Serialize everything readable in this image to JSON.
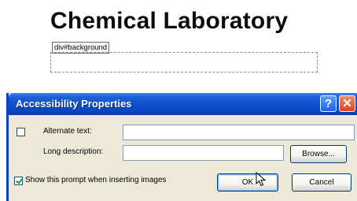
{
  "editor": {
    "title": "Chemical Laboratory",
    "div_tag": "div#background"
  },
  "dialog": {
    "title": "Accessibility Properties",
    "help_glyph": "?",
    "close_glyph": "✕",
    "alternate_text_label": "Alternate text:",
    "alternate_text_value": "",
    "alternate_text_checked": false,
    "long_description_label": "Long description:",
    "long_description_value": "",
    "browse_label": "Browse...",
    "show_prompt_label": "Show this prompt when inserting images",
    "show_prompt_checked": true,
    "ok_label": "OK",
    "cancel_label": "Cancel"
  },
  "colors": {
    "titlebar": "#0b4fd0",
    "dialog_bg": "#ece9d8",
    "close_button": "#d9432b",
    "check_mark": "#21a121"
  },
  "icons": {
    "help": "help-icon",
    "close": "close-icon",
    "cursor": "mouse-pointer-icon"
  }
}
